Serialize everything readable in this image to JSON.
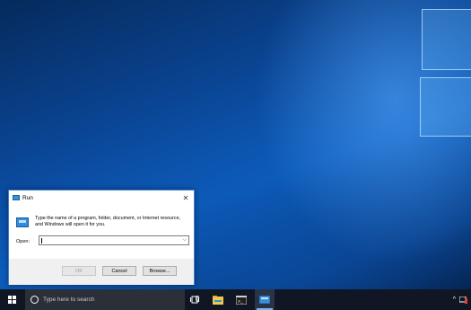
{
  "run_dialog": {
    "title": "Run",
    "close_glyph": "✕",
    "instructions": "Type the name of a program, folder, document, or Internet resource, and Windows will open it for you.",
    "open_label": "Open:",
    "open_value": "",
    "dropdown_glyph": "⌵",
    "buttons": {
      "ok": "OK",
      "cancel": "Cancel",
      "browse": "Browse..."
    }
  },
  "taskbar": {
    "search_placeholder": "Type here to search",
    "tray_chevron": "^"
  },
  "colors": {
    "taskbar_bg": "#101623",
    "accent": "#3f7fcf",
    "active_indicator": "#76b9ed"
  },
  "icons": [
    "windows-start-icon",
    "cortana-icon",
    "microphone-icon",
    "task-view-icon",
    "file-explorer-icon",
    "command-prompt-icon",
    "run-app-icon"
  ]
}
